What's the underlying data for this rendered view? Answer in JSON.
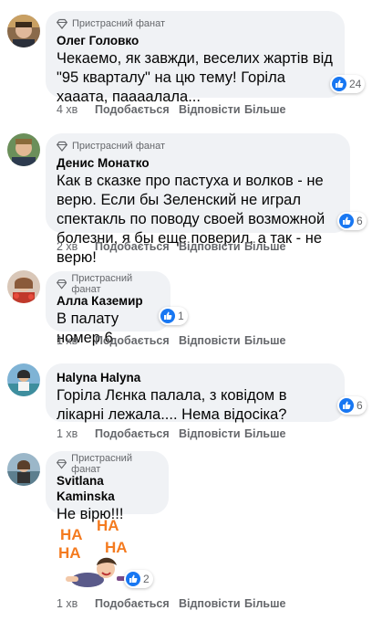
{
  "comments": [
    {
      "badge": "Пристрасний фанат",
      "author": "Олег Головко",
      "text": "Чекаемо, як завжди, веселих жартів від \"95 кварталу\" на цю тему! Горіла хааата, паааалала...",
      "reactions": "24",
      "time": "4 хв",
      "like": "Подобається",
      "reply": "Відповісти",
      "more": "Більше"
    },
    {
      "badge": "Пристрасний фанат",
      "author": "Денис Монатко",
      "text": "Как в сказке про пастуха и волков - не верю. Если бы Зеленский не играл спектакль по поводу своей возможной болезни, я бы еще поверил, а так - не верю!",
      "reactions": "6",
      "time": "2 хв",
      "like": "Подобається",
      "reply": "Відповісти",
      "more": "Більше"
    },
    {
      "badge": "Пристрасний фанат",
      "author": "Алла Каземир",
      "text": "В палату номер 6",
      "reactions": "1",
      "time": "1 хв",
      "like": "Подобається",
      "reply": "Відповісти",
      "more": "Більше"
    },
    {
      "badge": "",
      "author": "Halyna Halyna",
      "text": "Горіла Лєнка палала, з ковідом в лікарні лежала.... Нема відосіка?",
      "reactions": "6",
      "time": "1 хв",
      "like": "Подобається",
      "reply": "Відповісти",
      "more": "Більше"
    },
    {
      "badge": "Пристрасний фанат",
      "author": "Svitlana Kaminska",
      "text": "Не вірю!!!",
      "reactions": "2",
      "time": "1 хв",
      "like": "Подобається",
      "reply": "Відповісти",
      "more": "Більше",
      "sticker": "HA HA HA HA"
    }
  ],
  "colors": {
    "bubble": "#f0f2f5",
    "like_blue": "#1877f2",
    "meta": "#65676b",
    "sticker_orange": "#f47b20"
  },
  "icons": {
    "badge": "diamond-icon",
    "reaction": "like-icon"
  }
}
